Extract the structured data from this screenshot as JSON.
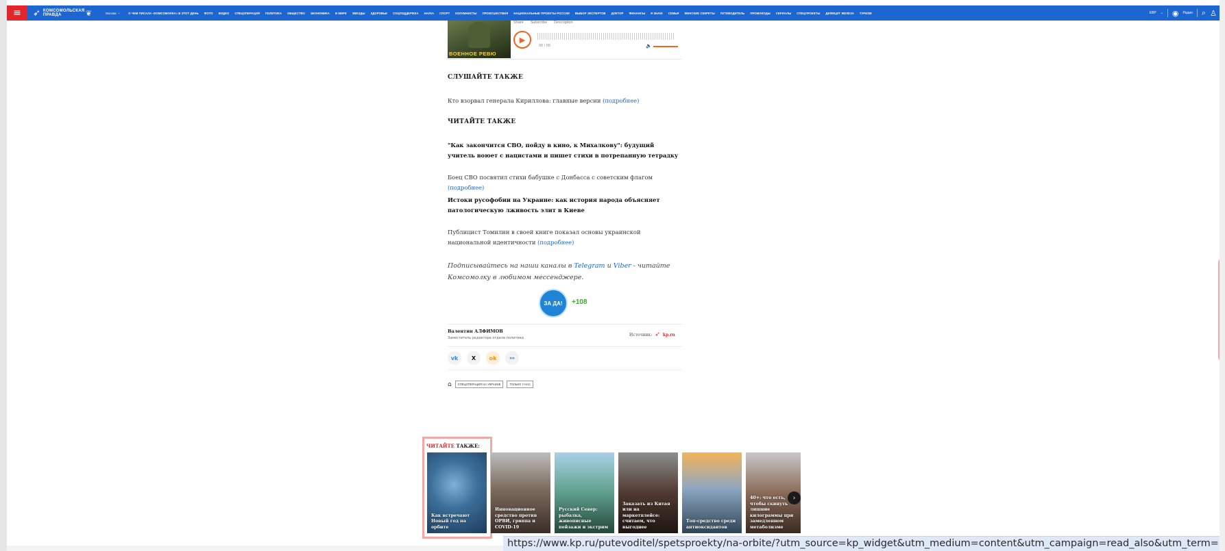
{
  "topbar": {
    "logo_text": "КОМСОМОЛЬСКАЯ ПРАВДА",
    "city": "Москва",
    "nav": [
      "О ЧЕМ ПИСАЛА «КОМСОМОЛКА» В ЭТОТ ДЕНЬ",
      "ФОТО",
      "ВИДЕО",
      "СПЕЦОПЕРАЦИЯ",
      "ПОЛИТИКА",
      "ОБЩЕСТВО",
      "ЭКОНОМИКА",
      "В МИРЕ",
      "ЗВЕЗДЫ",
      "ЗДОРОВЬЕ",
      "СОЦПОДДЕРЖКА",
      "НАУКА",
      "СПОРТ",
      "КОЛУМНИСТЫ",
      "ПРОИСШЕСТВИЯ",
      "НАЦИОНАЛЬНЫЕ ПРОЕКТЫ РОССИИ",
      "ВЫБОР ЭКСПЕРТОВ",
      "ДОКТОР",
      "ФИНАНСЫ",
      "Я ЗНАЮ",
      "СЕМЬЯ",
      "ЖЕНСКИЕ СЕКРЕТЫ",
      "ПУТЕВОДИТЕЛЬ",
      "ПРОМОКОДЫ",
      "СЕРИАЛЫ",
      "СПЕЦПРОЕКТЫ",
      "ДЕФИЦИТ ЖЕЛЕЗА",
      "ТУРИЗМ"
    ],
    "currency": "ЕВР",
    "radio": "Радио"
  },
  "player": {
    "cover_caption": "ВОЕННОЕ РЕВЮ",
    "share": "Share",
    "subscribe": "Subscribe",
    "description": "Description",
    "time": "00 / 00"
  },
  "article": {
    "listen_heading": "СЛУШАЙТЕ ТАКЖЕ",
    "listen_text": "Кто взорвал генерала Кириллова: главные версии",
    "more": "(подробнее)",
    "read_heading": "ЧИТАЙТЕ ТАКЖЕ",
    "item1_title": "\"Как закончится СВО, пойду в кино, к Михалкову\": будущий учитель воюет с нацистами и пишет стихи в потрепанную тетрадку",
    "item1_text": "Боец СВО посвятил стихи бабушке с Донбасса с советским флагом",
    "item2_title": "Истоки русофобии на Украине: как история народа объясняет патологическую лживость элит в Киеве",
    "item2_text": "Публицист Томилин в своей книге показал основы украинской национальной идентичности",
    "subscribe_a": "Подписывайтесь на наши каналы в ",
    "telegram": "Telegram",
    "subscribe_and": " и ",
    "viber": "Viber",
    "subscribe_b": " - читайте Комсомолку в любимом мессенджере."
  },
  "vote": {
    "label": "ЗА ДА!",
    "count": "+108"
  },
  "author": {
    "name": "Валентин АЛФИМОВ",
    "role": "Заместитель редактора отдела политики",
    "source_label": "Источник:",
    "source_name": "kp.ru"
  },
  "shares": {
    "vk": "vk",
    "x": "X",
    "ok": "ok",
    "link": "⚯"
  },
  "tags": [
    "СПЕЦОПЕРАЦИЯ НА УКРАИНЕ",
    "ТОЛЬКО У НАС"
  ],
  "read_also": {
    "title_red": "ЧИТАЙТЕ",
    "title_rest": " ТАКЖЕ:",
    "cards": [
      "Как встречают Новый год на орбите",
      "Инновационное средство против ОРВИ, гриппа и COVID-19",
      "Русский Север: рыбалка, живописные пейзажи и экстрим",
      "Заказать из Китая или на маркетплейсе: считаем, что выгоднее",
      "Топ-средство среди антиоксидантов",
      "40+: что есть, чтобы скинуть лишние килограммы при замедленном метаболизме"
    ]
  },
  "status_url": "https://www.kp.ru/putevoditel/spetsproekty/na-orbite/?utm_source=kp_widget&utm_medium=content&utm_campaign=read_also&utm_term="
}
